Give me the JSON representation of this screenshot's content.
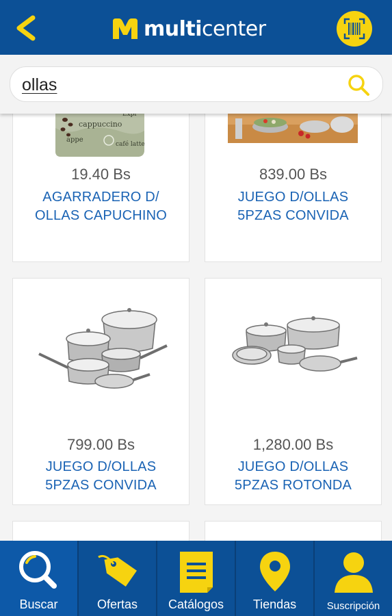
{
  "header": {
    "logo_text_bold": "multi",
    "logo_text_regular": "center",
    "back_icon": "back-arrow-icon",
    "barcode_icon": "barcode-scan-icon",
    "accent_color": "#f6d310",
    "bar_color": "#0c5096"
  },
  "search": {
    "query": "ollas",
    "icon": "search-icon"
  },
  "products": [
    {
      "price": "19.40 Bs",
      "name_line1": "AGARRADERO D/",
      "name_line2": "OLLAS CAPUCHINO"
    },
    {
      "price": "839.00 Bs",
      "name_line1": "JUEGO D/OLLAS",
      "name_line2": "5PZAS CONVIDA"
    },
    {
      "price": "799.00 Bs",
      "name_line1": "JUEGO D/OLLAS",
      "name_line2": "5PZAS CONVIDA"
    },
    {
      "price": "1,280.00 Bs",
      "name_line1": "JUEGO D/OLLAS",
      "name_line2": "5PZAS ROTONDA"
    }
  ],
  "bottom_nav": [
    {
      "label": "Buscar",
      "icon": "search-icon",
      "active": true
    },
    {
      "label": "Ofertas",
      "icon": "price-tag-icon",
      "active": false
    },
    {
      "label": "Catálogos",
      "icon": "catalog-icon",
      "active": false
    },
    {
      "label": "Tiendas",
      "icon": "location-pin-icon",
      "active": false
    },
    {
      "label": "Suscripción",
      "icon": "user-icon",
      "active": false
    }
  ]
}
